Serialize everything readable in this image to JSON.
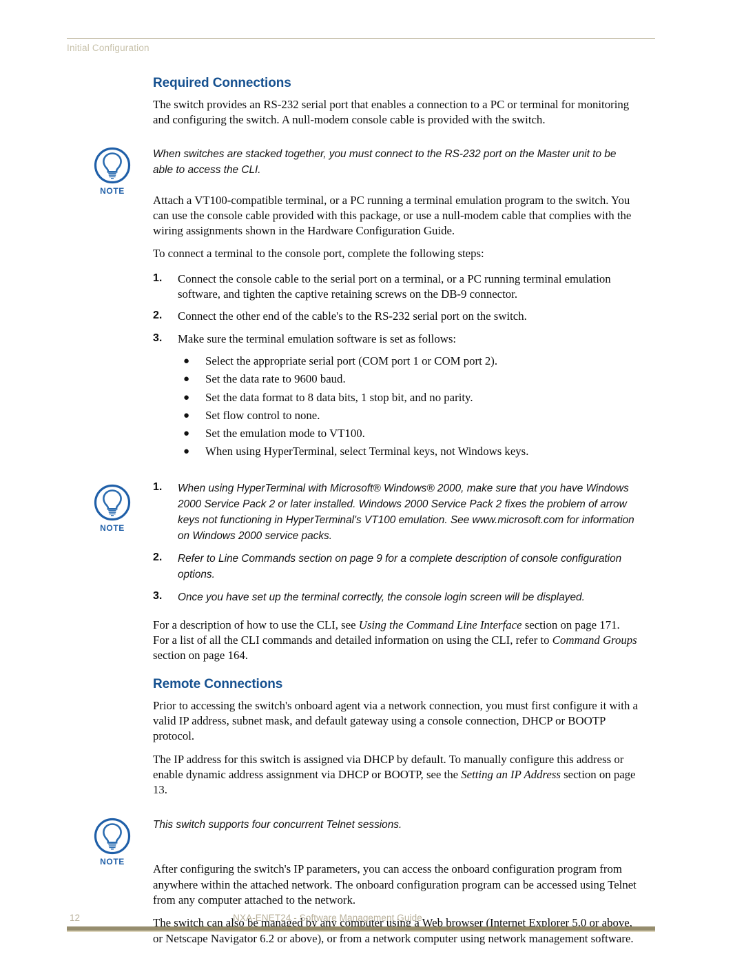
{
  "header": {
    "running_head": "Initial Configuration"
  },
  "footer": {
    "page_number": "12",
    "document_title": "NXA-ENET24 - Software Management Guide"
  },
  "colors": {
    "heading_blue": "#15508F",
    "note_icon_blue": "#1F5FA8",
    "rule_khaki": "#968D6E",
    "header_text": "#C8C2AB"
  },
  "icons": {
    "note_label": "NOTE",
    "note_icon_name": "lightbulb-note-icon"
  },
  "sections": {
    "required_connections": {
      "heading": "Required Connections",
      "intro": "The switch provides an RS-232 serial port that enables a connection to a PC or terminal for monitoring and configuring the switch. A null-modem console cable is provided with the switch.",
      "note_1": "When switches are stacked together, you must connect to the RS-232 port on the Master unit to be able to access the CLI.",
      "para_2": "Attach a VT100-compatible terminal, or a PC running a terminal emulation program to the switch. You can use the console cable provided with this package, or use a null-modem cable that complies with the wiring assignments shown in the Hardware Configuration Guide.",
      "para_3": "To connect a terminal to the console port, complete the following steps:",
      "steps": [
        {
          "number": "1.",
          "text": "Connect the console cable to the serial port on a terminal, or a PC running terminal emulation software, and tighten the captive retaining screws on the DB-9 connector."
        },
        {
          "number": "2.",
          "text": "Connect the other end of the cable's to the RS-232 serial port on the switch."
        },
        {
          "number": "3.",
          "text": "Make sure the terminal emulation software is set as follows:"
        }
      ],
      "bullets": [
        "Select the appropriate serial port (COM port 1 or COM port 2).",
        "Set the data rate to 9600 baud.",
        "Set the data format to 8 data bits, 1 stop bit, and no parity.",
        "Set flow control to none.",
        "Set the emulation mode to VT100.",
        "When using HyperTerminal, select Terminal keys, not Windows keys."
      ],
      "note_2_items": [
        {
          "number": "1.",
          "text": "When using HyperTerminal with Microsoft® Windows® 2000, make sure that you have Windows 2000 Service Pack 2 or later installed. Windows 2000 Service Pack 2 fixes the problem of arrow keys not functioning in HyperTerminal's VT100 emulation. See www.microsoft.com for information on Windows 2000 service packs."
        },
        {
          "number": "2.",
          "text": "Refer to Line Commands section on page 9 for a complete description of console configuration options."
        },
        {
          "number": "3.",
          "text": "Once you have set up the terminal correctly, the console login screen will be displayed."
        }
      ],
      "closing_para": {
        "part_1": "For a description of how to use the CLI, see ",
        "italic_1": "Using the Command Line Interface",
        "part_2": " section on page 171. For a list of all the CLI commands and detailed information on using the CLI, refer to ",
        "italic_2": "Command Groups",
        "part_3": " section on page 164."
      }
    },
    "remote_connections": {
      "heading": "Remote Connections",
      "para_1": "Prior to accessing the switch's onboard agent via a network connection, you must first configure it with a valid IP address, subnet mask, and default gateway using a console connection, DHCP or BOOTP protocol.",
      "para_2": {
        "part_1": "The IP address for this switch is assigned via DHCP by default. To manually configure this address or enable dynamic address assignment via DHCP or BOOTP, see the ",
        "italic_1": "Setting an IP Address",
        "part_2": " section on page 13."
      },
      "note_3": "This switch supports four concurrent Telnet sessions.",
      "para_3": "After configuring the switch's IP parameters, you can access the onboard configuration program from anywhere within the attached network. The onboard configuration program can be accessed using Telnet from any computer attached to the network.",
      "para_4": "The switch can also be managed by any computer using a Web browser (Internet Explorer 5.0 or above, or Netscape Navigator 6.2 or above), or from a network computer using network management software."
    }
  }
}
